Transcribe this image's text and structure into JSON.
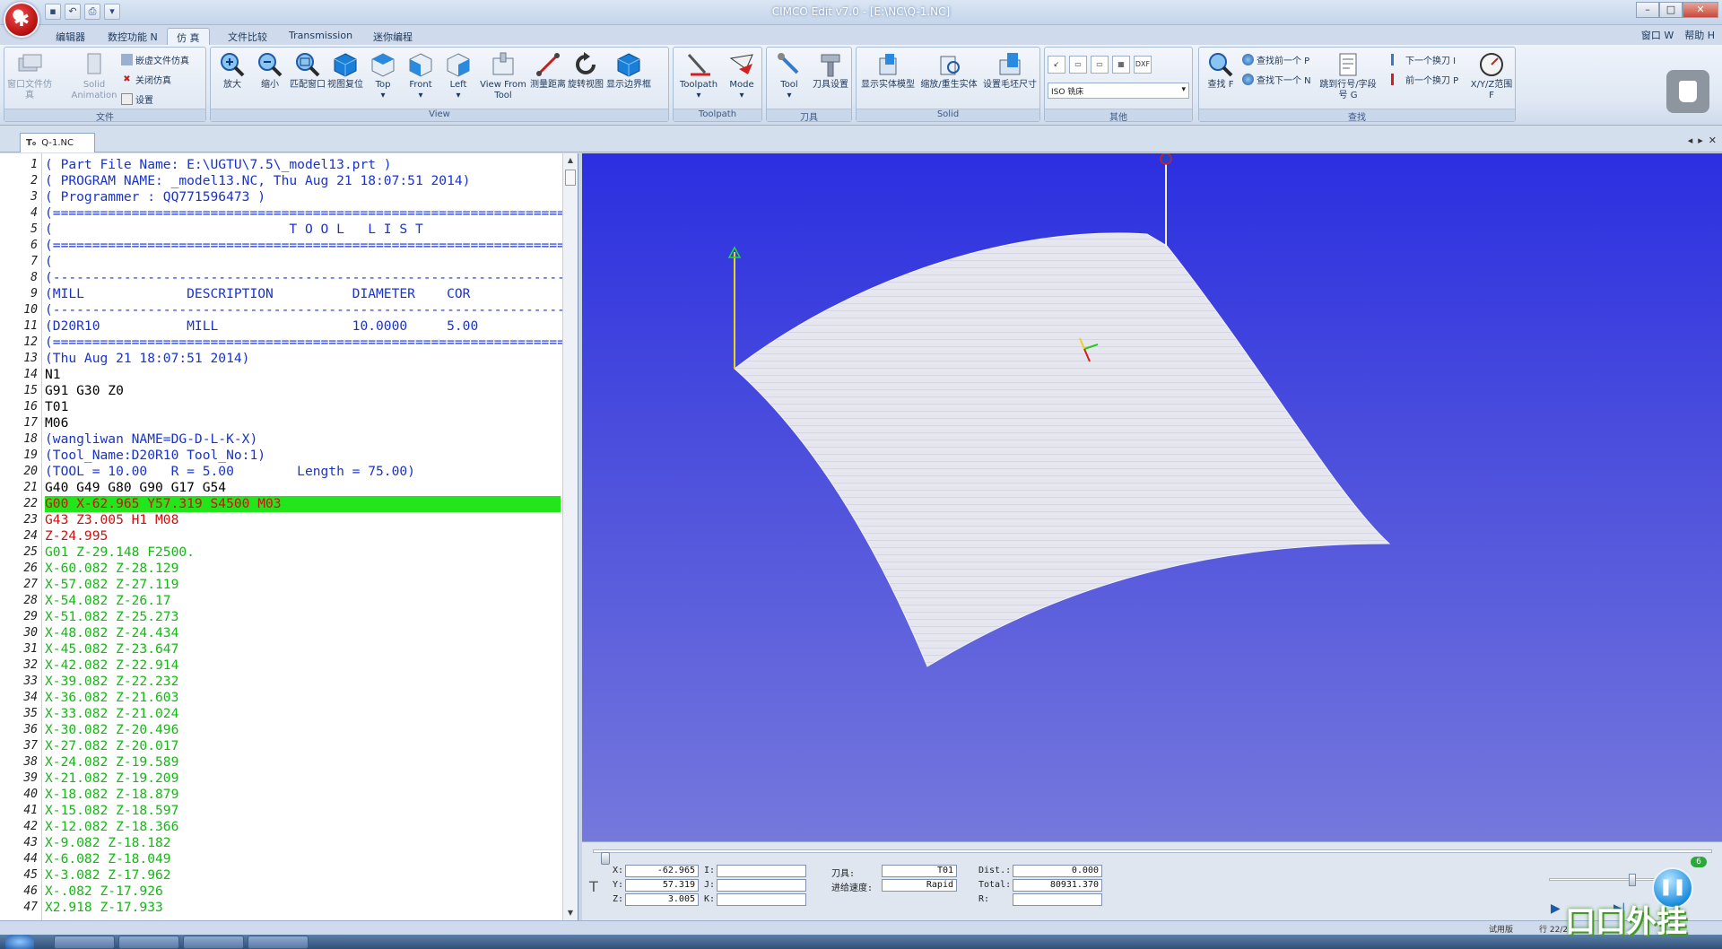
{
  "window": {
    "title": "CIMCO Edit v7.0 - [E:\\NC\\Q-1.NC]"
  },
  "ribbon_tabs": [
    "编辑器",
    "数控功能 N",
    "仿 真",
    "文件比较",
    "Transmission",
    "迷你编程"
  ],
  "ribbon_tabs_right": [
    "窗口 W",
    "帮助 H"
  ],
  "groups": {
    "file": {
      "label": "文件",
      "buttons": [
        "窗口文件仿真",
        "Solid Animation"
      ],
      "small": [
        "嵌虚文件仿真",
        "关闭仿真",
        "设置"
      ]
    },
    "view": {
      "label": "View",
      "buttons": [
        "放大",
        "缩小",
        "匹配窗口",
        "视图复位",
        "Top",
        "Front",
        "Left",
        "View From Tool",
        "测量距离",
        "旋转视图",
        "显示边界框"
      ]
    },
    "toolpath": {
      "label": "Toolpath",
      "buttons": [
        "Toolpath",
        "Mode"
      ]
    },
    "tool": {
      "label": "刀具",
      "buttons": [
        "Tool",
        "刀具设置"
      ]
    },
    "solid": {
      "label": "Solid",
      "buttons": [
        "显示实体模型",
        "缩放/重生实体",
        "设置毛坯尺寸"
      ]
    },
    "other": {
      "label": "其他",
      "combo_value": "ISO 铣床",
      "mini": [
        "DXF"
      ]
    },
    "find": {
      "label": "查找",
      "buttons": [
        "查找 F",
        "跳到行号/字段号 G",
        "X/Y/Z范围 F"
      ],
      "small": [
        "查找前一个 P",
        "查找下一个 N",
        "下一个换刀 I",
        "前一个换刀 P"
      ]
    }
  },
  "document_tab": "Q-1.NC",
  "code": {
    "lines": [
      {
        "n": "1",
        "text": "( Part File Name: E:\\UGTU\\7.5\\_model13.prt )",
        "color": "#1a33c8"
      },
      {
        "n": "2",
        "text": "( PROGRAM NAME: _model13.NC, Thu Aug 21 18:07:51 2014)",
        "color": "#1a33c8"
      },
      {
        "n": "3",
        "text": "( Programmer : QQ771596473 )",
        "color": "#1a33c8"
      },
      {
        "n": "4",
        "text": "(=================================================================",
        "color": "#1a33c8"
      },
      {
        "n": "5",
        "text": "(                              T O O L   L I S T",
        "color": "#1a33c8"
      },
      {
        "n": "6",
        "text": "(=================================================================",
        "color": "#1a33c8"
      },
      {
        "n": "7",
        "text": "(",
        "color": "#1a33c8"
      },
      {
        "n": "8",
        "text": "(-----------------------------------------------------------------",
        "color": "#1a33c8"
      },
      {
        "n": "9",
        "text": "(MILL             DESCRIPTION          DIAMETER    COR",
        "color": "#1a33c8"
      },
      {
        "n": "10",
        "text": "(-----------------------------------------------------------------",
        "color": "#1a33c8"
      },
      {
        "n": "11",
        "text": "(D20R10           MILL                 10.0000     5.00",
        "color": "#1a33c8"
      },
      {
        "n": "12",
        "text": "(=================================================================",
        "color": "#1a33c8"
      },
      {
        "n": "13",
        "text": "(Thu Aug 21 18:07:51 2014)",
        "color": "#1a33c8"
      },
      {
        "n": "14",
        "text": "N1",
        "color": "#000000"
      },
      {
        "n": "15",
        "text": "G91 G30 Z0",
        "color": "#000000"
      },
      {
        "n": "16",
        "text": "T01",
        "color": "#000000"
      },
      {
        "n": "17",
        "text": "M06",
        "color": "#000000"
      },
      {
        "n": "18",
        "text": "(wangliwan NAME=DG-D-L-K-X)",
        "color": "#1a33c8"
      },
      {
        "n": "19",
        "text": "(Tool_Name:D20R10 Tool_No:1)",
        "color": "#1a33c8"
      },
      {
        "n": "20",
        "text": "(TOOL = 10.00   R = 5.00        Length = 75.00)",
        "color": "#1a33c8"
      },
      {
        "n": "21",
        "text": "G40 G49 G80 G90 G17 G54",
        "color": "#000000"
      },
      {
        "n": "22",
        "text": "G00 X-62.965 Y57.319 S4500 M03",
        "color": "#d01010",
        "highlight": true
      },
      {
        "n": "23",
        "text": "G43 Z3.005 H1 M08",
        "color": "#d01010"
      },
      {
        "n": "24",
        "text": "Z-24.995",
        "color": "#d01010"
      },
      {
        "n": "25",
        "text": "G01 Z-29.148 F2500.",
        "color": "#14b814"
      },
      {
        "n": "26",
        "text": "X-60.082 Z-28.129",
        "color": "#14b814"
      },
      {
        "n": "27",
        "text": "X-57.082 Z-27.119",
        "color": "#14b814"
      },
      {
        "n": "28",
        "text": "X-54.082 Z-26.17",
        "color": "#14b814"
      },
      {
        "n": "29",
        "text": "X-51.082 Z-25.273",
        "color": "#14b814"
      },
      {
        "n": "30",
        "text": "X-48.082 Z-24.434",
        "color": "#14b814"
      },
      {
        "n": "31",
        "text": "X-45.082 Z-23.647",
        "color": "#14b814"
      },
      {
        "n": "32",
        "text": "X-42.082 Z-22.914",
        "color": "#14b814"
      },
      {
        "n": "33",
        "text": "X-39.082 Z-22.232",
        "color": "#14b814"
      },
      {
        "n": "34",
        "text": "X-36.082 Z-21.603",
        "color": "#14b814"
      },
      {
        "n": "35",
        "text": "X-33.082 Z-21.024",
        "color": "#14b814"
      },
      {
        "n": "36",
        "text": "X-30.082 Z-20.496",
        "color": "#14b814"
      },
      {
        "n": "37",
        "text": "X-27.082 Z-20.017",
        "color": "#14b814"
      },
      {
        "n": "38",
        "text": "X-24.082 Z-19.589",
        "color": "#14b814"
      },
      {
        "n": "39",
        "text": "X-21.082 Z-19.209",
        "color": "#14b814"
      },
      {
        "n": "40",
        "text": "X-18.082 Z-18.879",
        "color": "#14b814"
      },
      {
        "n": "41",
        "text": "X-15.082 Z-18.597",
        "color": "#14b814"
      },
      {
        "n": "42",
        "text": "X-12.082 Z-18.366",
        "color": "#14b814"
      },
      {
        "n": "43",
        "text": "X-9.082 Z-18.182",
        "color": "#14b814"
      },
      {
        "n": "44",
        "text": "X-6.082 Z-18.049",
        "color": "#14b814"
      },
      {
        "n": "45",
        "text": "X-3.082 Z-17.962",
        "color": "#14b814"
      },
      {
        "n": "46",
        "text": "X-.082 Z-17.926",
        "color": "#14b814"
      },
      {
        "n": "47",
        "text": "X2.918 Z-17.933",
        "color": "#14b814"
      }
    ]
  },
  "sim": {
    "x_label": "X:",
    "x": "-62.965",
    "y_label": "Y:",
    "y": "57.319",
    "z_label": "Z:",
    "z": "3.005",
    "i_label": "I:",
    "j_label": "J:",
    "k_label": "K:",
    "tool_label": "刀具:",
    "tool": "T01",
    "feed_label": "进给速度:",
    "feed": "Rapid",
    "dist_label": "Dist.:",
    "dist": "0.000",
    "total_label": "Total:",
    "total": "80931.370",
    "r_label": "R:",
    "speed_badge": "6"
  },
  "status": {
    "left": "试用版",
    "right": "行 22/2"
  },
  "watermark": "口口外挂",
  "colors": {
    "highlight": "#22e51c",
    "viewport_top": "#2b2fe0",
    "viewport_bottom": "#7578dc",
    "surface": "#e4e4ec"
  }
}
